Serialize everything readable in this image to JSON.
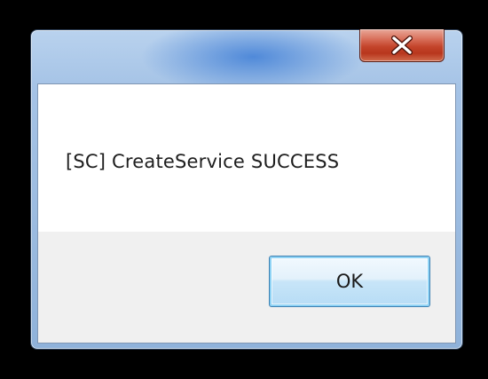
{
  "window": {
    "close_icon": "close-icon",
    "accent_color": "#c3442a"
  },
  "dialog": {
    "message": "[SC] CreateService SUCCESS",
    "ok_label": "OK"
  }
}
